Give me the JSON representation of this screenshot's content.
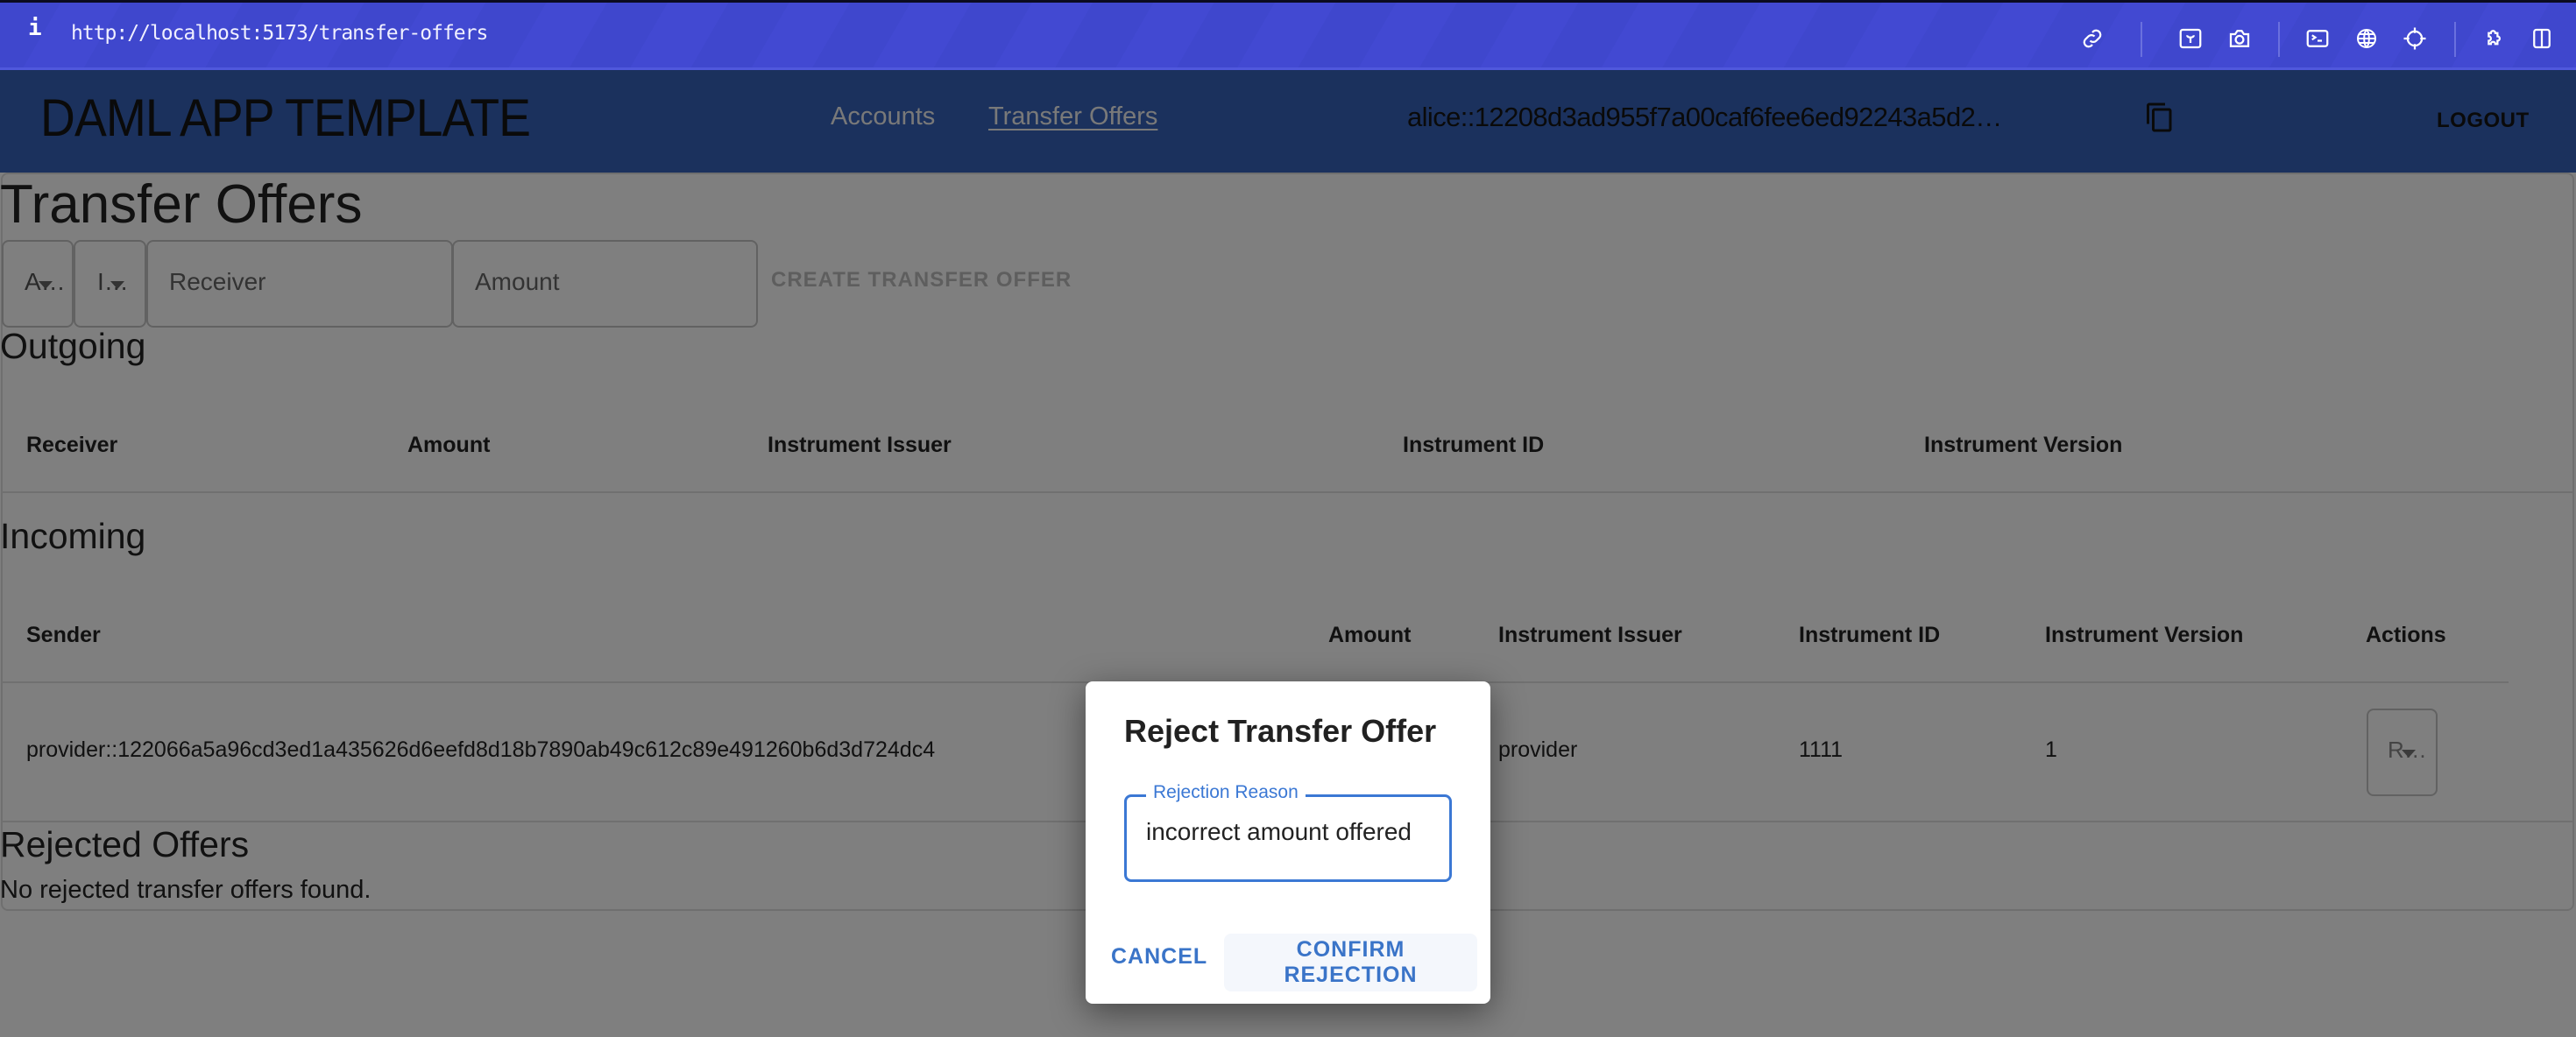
{
  "browser": {
    "info_icon": "i",
    "url": "http://localhost:5173/transfer-offers",
    "toolbar_icons": [
      "link-icon",
      "image-icon",
      "camera-icon",
      "terminal-icon",
      "globe-icon",
      "crosshair-icon",
      "puzzle-icon",
      "split-panel-icon"
    ]
  },
  "appbar": {
    "title": "DAML APP TEMPLATE",
    "nav": [
      {
        "label": "Accounts",
        "active": false
      },
      {
        "label": "Transfer Offers",
        "active": true
      }
    ],
    "party": "alice::12208d3ad955f7a00caf6fee6ed92243a5d2…",
    "copy_icon": "copy-icon",
    "logout_label": "LOGOUT"
  },
  "page": {
    "title": "Transfer Offers",
    "form": {
      "account_select": "A…",
      "instrument_select": "I…",
      "receiver_placeholder": "Receiver",
      "amount_placeholder": "Amount",
      "create_label": "CREATE TRANSFER OFFER"
    },
    "outgoing": {
      "title": "Outgoing",
      "columns": [
        "Receiver",
        "Amount",
        "Instrument Issuer",
        "Instrument ID",
        "Instrument Version"
      ],
      "rows": []
    },
    "incoming": {
      "title": "Incoming",
      "columns": [
        "Sender",
        "Amount",
        "Instrument Issuer",
        "Instrument ID",
        "Instrument Version",
        "Actions"
      ],
      "rows": [
        {
          "sender": "provider::122066a5a96cd3ed1a435626d6eefd8d18b7890ab49c612c89e491260b6d3d724dc4",
          "instrument_issuer": "provider",
          "instrument_id": "1111",
          "instrument_version": "1",
          "action_select": "R…"
        }
      ]
    },
    "rejected": {
      "title": "Rejected Offers",
      "empty_message": "No rejected transfer offers found."
    }
  },
  "dialog": {
    "title": "Reject Transfer Offer",
    "reason_label": "Rejection Reason",
    "reason_value": "incorrect amount offered",
    "cancel_label": "CANCEL",
    "confirm_label": "CONFIRM REJECTION",
    "accent_color": "#3b78d4"
  }
}
